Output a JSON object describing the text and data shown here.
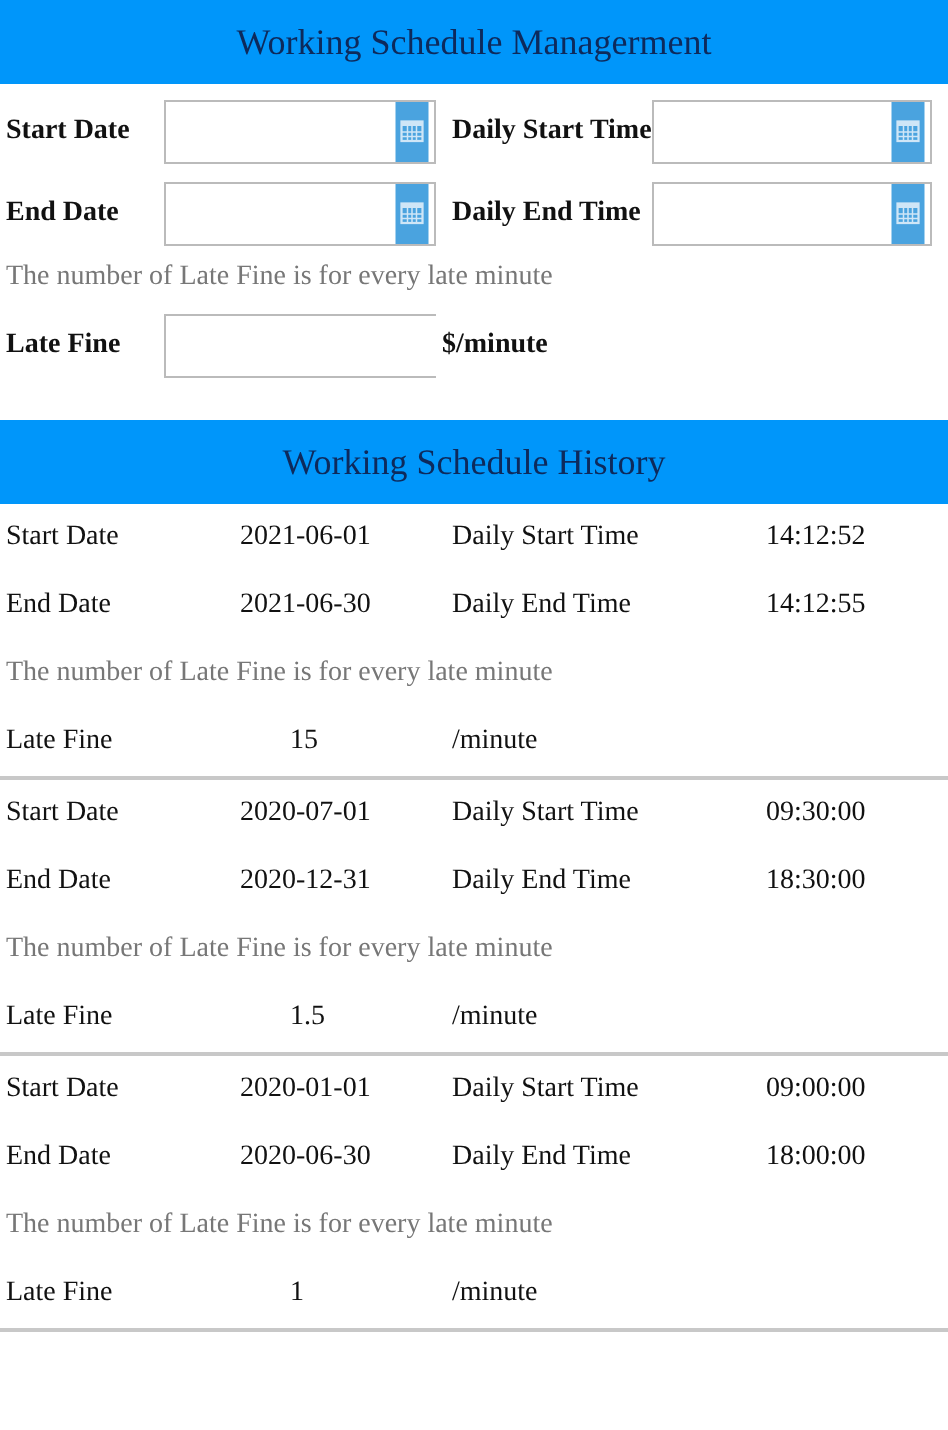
{
  "form": {
    "title": "Working Schedule Managerment",
    "fields": [
      {
        "label": "Start Date"
      },
      {
        "label": "Daily Start Time"
      },
      {
        "label": "End Date"
      },
      {
        "label": "Daily End Time"
      }
    ],
    "note": "The number of Late Fine is for every late minute",
    "late_fine": {
      "label": "Late Fine",
      "unit": "$/minute"
    }
  },
  "history": {
    "title": "Working Schedule History",
    "entries": [
      {
        "start_date_label": "Start Date",
        "start_date": "2021-06-01",
        "start_time_label": "Daily Start Time",
        "start_time": "14:12:52",
        "end_date_label": "End Date",
        "end_date": "2021-06-30",
        "end_time_label": "Daily End Time",
        "end_time": "14:12:55",
        "note": "The number of Late Fine is for every late minute",
        "fine_label": "Late Fine",
        "fine": "15",
        "unit": "/minute"
      },
      {
        "start_date_label": "Start Date",
        "start_date": "2020-07-01",
        "start_time_label": "Daily Start Time",
        "start_time": "09:30:00",
        "end_date_label": "End Date",
        "end_date": "2020-12-31",
        "end_time_label": "Daily End Time",
        "end_time": "18:30:00",
        "note": "The number of Late Fine is for every late minute",
        "fine_label": "Late Fine",
        "fine": "1.5",
        "unit": "/minute"
      },
      {
        "start_date_label": "Start Date",
        "start_date": "2020-01-01",
        "start_time_label": "Daily Start Time",
        "start_time": "09:00:00",
        "end_date_label": "End Date",
        "end_date": "2020-06-30",
        "end_time_label": "Daily End Time",
        "end_time": "18:00:00",
        "note": "The number of Late Fine is for every late minute",
        "fine_label": "Late Fine",
        "fine": "1",
        "unit": "/minute"
      }
    ]
  }
}
